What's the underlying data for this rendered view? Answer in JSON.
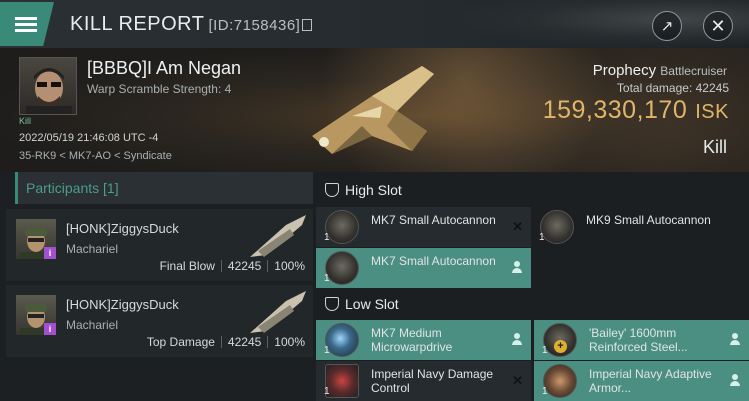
{
  "header": {
    "title": "KILL REPORT",
    "id_text": "[ID:7158436]"
  },
  "victim": {
    "name": "[BBBQ]I Am Negan",
    "warp_scramble": "Warp Scramble Strength: 4",
    "kill_tag": "Kill",
    "timestamp": "2022/05/19 21:46:08 UTC -4",
    "location": "35-RK9 < MK7-AO < Syndicate"
  },
  "ship": {
    "name": "Prophecy",
    "class": "Battlecruiser",
    "total_damage_label": "Total damage:",
    "total_damage": "42245",
    "isk_value": "159,330,170",
    "isk_unit": "ISK",
    "result": "Kill"
  },
  "participants": {
    "header": "Participants [1]",
    "rows": [
      {
        "name": "[HONK]ZiggysDuck",
        "ship": "Machariel",
        "role": "Final Blow",
        "damage": "42245",
        "percent": "100%"
      },
      {
        "name": "[HONK]ZiggysDuck",
        "ship": "Machariel",
        "role": "Top Damage",
        "damage": "42245",
        "percent": "100%"
      }
    ]
  },
  "slots": {
    "high": {
      "label": "High Slot",
      "items": [
        {
          "name": "MK7 Small Autocannon",
          "qty": "1",
          "status": "destroyed"
        },
        {
          "name": "MK9 Small Autocannon",
          "qty": "1",
          "status": "dropped"
        },
        {
          "name": "MK7 Small Autocannon",
          "qty": "1",
          "status": "dropped"
        }
      ]
    },
    "low": {
      "label": "Low Slot",
      "items": [
        {
          "name": "MK7 Medium Microwarpdrive",
          "qty": "1",
          "status": "dropped"
        },
        {
          "name": "'Bailey' 1600mm Reinforced Steel...",
          "qty": "1",
          "status": "dropped"
        },
        {
          "name": "Imperial Navy Damage Control",
          "qty": "1",
          "status": "destroyed"
        },
        {
          "name": "Imperial Navy Adaptive Armor...",
          "qty": "1",
          "status": "dropped"
        }
      ]
    }
  },
  "colors": {
    "accent": "#3a8a79",
    "isk": "#e0b56a",
    "dropped_bg": "#4b8f82"
  }
}
